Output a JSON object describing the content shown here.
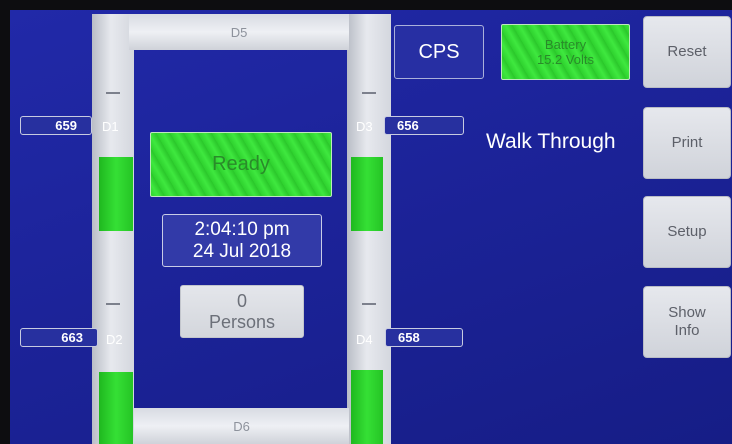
{
  "doors": {
    "d1": {
      "label": "D1",
      "count": "659"
    },
    "d2": {
      "label": "D2",
      "count": "663"
    },
    "d3": {
      "label": "D3",
      "count": "656"
    },
    "d4": {
      "label": "D4",
      "count": "658"
    },
    "d5": {
      "label": "D5"
    },
    "d6": {
      "label": "D6"
    }
  },
  "status": {
    "ready_label": "Ready"
  },
  "datetime": {
    "time": "2:04:10 pm",
    "date": "24 Jul 2018"
  },
  "persons": {
    "count": "0",
    "label": "Persons"
  },
  "header": {
    "cps_label": "CPS",
    "battery_label": "Battery",
    "battery_value": "15.2 Volts"
  },
  "mode": {
    "label": "Walk Through"
  },
  "buttons": {
    "reset": "Reset",
    "print": "Print",
    "setup": "Setup",
    "show_info_line1": "Show",
    "show_info_line2": "Info"
  },
  "colors": {
    "screen_blue": "#1c2399",
    "sensor_green": "#35e035",
    "panel_white": "#e4e6eb"
  }
}
